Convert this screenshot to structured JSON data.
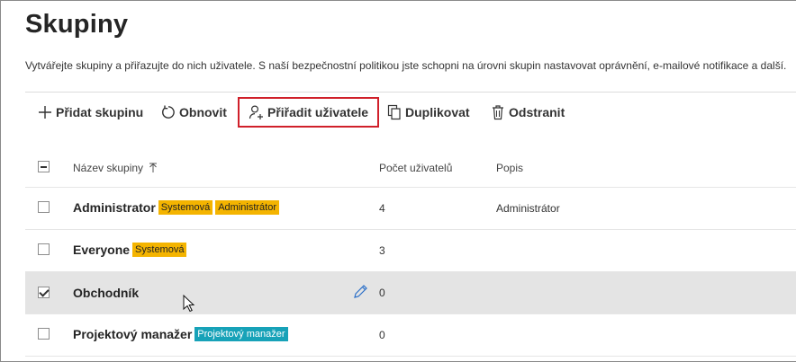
{
  "page": {
    "title": "Skupiny",
    "description": "Vytvářejte skupiny a přiřazujte do nich uživatele. S naší bezpečnostní politikou jste schopni na úrovni skupin nastavovat oprávnění, e-mailové notifikace a další."
  },
  "toolbar": {
    "add_group": "Přidat skupinu",
    "refresh": "Obnovit",
    "assign_users": "Přiřadit uživatele",
    "duplicate": "Duplikovat",
    "delete": "Odstranit"
  },
  "table": {
    "headers": {
      "name": "Název skupiny",
      "user_count": "Počet uživatelů",
      "description": "Popis"
    },
    "rows": [
      {
        "name": "Administrator",
        "badges": [
          "Systemová",
          "Administrátor"
        ],
        "count": "4",
        "description": "Administrátor",
        "checked": false
      },
      {
        "name": "Everyone",
        "badges": [
          "Systemová"
        ],
        "count": "3",
        "description": "",
        "checked": false
      },
      {
        "name": "Obchodník",
        "badges": [],
        "count": "0",
        "description": "",
        "checked": true
      },
      {
        "name": "Projektový manažer",
        "badges": [
          "Projektový manažer"
        ],
        "count": "0",
        "description": "",
        "checked": false
      }
    ]
  },
  "colors": {
    "badge_yellow": "#f4b400",
    "badge_teal": "#17a2b8",
    "highlight_border": "#d0202a",
    "selected_row": "#e4e4e4"
  }
}
